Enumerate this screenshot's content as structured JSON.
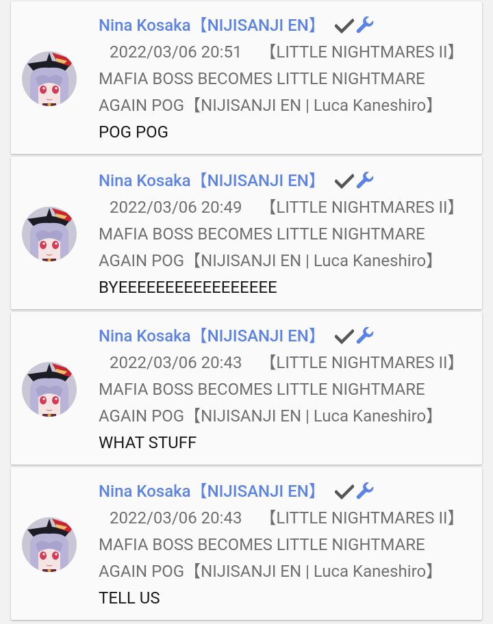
{
  "comments": [
    {
      "author": "Nina Kosaka【NIJISANJI EN】",
      "timestamp": "2022/03/06 20:51",
      "video_title": "【LITTLE NIGHTMARES II】MAFIA BOSS BECOMES LITTLE NIGHTMARE AGAIN POG【NIJISANJI EN | Luca Kaneshiro】",
      "message": "POG POG"
    },
    {
      "author": "Nina Kosaka【NIJISANJI EN】",
      "timestamp": "2022/03/06 20:49",
      "video_title": "【LITTLE NIGHTMARES II】MAFIA BOSS BECOMES LITTLE NIGHTMARE AGAIN POG【NIJISANJI EN | Luca Kaneshiro】",
      "message": "BYEEEEEEEEEEEEEEEEE"
    },
    {
      "author": "Nina Kosaka【NIJISANJI EN】",
      "timestamp": "2022/03/06 20:43",
      "video_title": "【LITTLE NIGHTMARES II】MAFIA BOSS BECOMES LITTLE NIGHTMARE AGAIN POG【NIJISANJI EN | Luca Kaneshiro】",
      "message": "WHAT STUFF"
    },
    {
      "author": "Nina Kosaka【NIJISANJI EN】",
      "timestamp": "2022/03/06 20:43",
      "video_title": "【LITTLE NIGHTMARES II】MAFIA BOSS BECOMES LITTLE NIGHTMARE AGAIN POG【NIJISANJI EN | Luca Kaneshiro】",
      "message": "TELL US"
    }
  ],
  "badges": {
    "verified_icon": "checkmark-icon",
    "moderator_icon": "wrench-icon"
  },
  "colors": {
    "author": "#5b83e6",
    "badge_check": "#555555",
    "badge_wrench": "#5b83e6",
    "meta_text": "#6f6f6f",
    "message_text": "#1a1a1a",
    "card_bg": "#fafafa",
    "page_bg": "#f2f2f2"
  }
}
